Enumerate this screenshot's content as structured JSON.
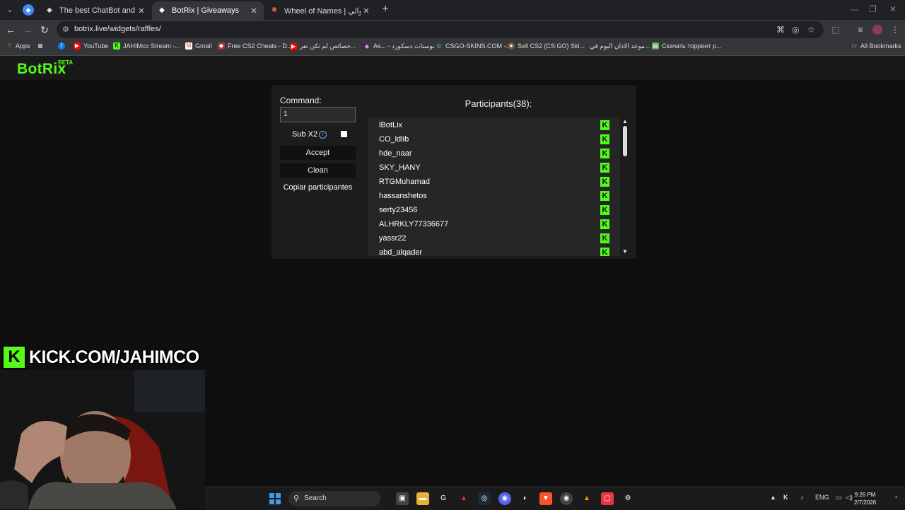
{
  "browser": {
    "tabs": [
      {
        "title": "The best ChatBot and Widgets",
        "favicon": "botrix-diamond-icon",
        "active": false
      },
      {
        "title": "BotRix | Giveaways",
        "favicon": "botrix-diamond-icon",
        "active": true
      },
      {
        "title": "Wheel of Names | اسم العشوائي",
        "favicon": "wheel-icon",
        "active": false
      }
    ],
    "url": "botrix.live/widgets/raffles/",
    "bookmarks": [
      {
        "label": "Apps",
        "icon": "apps-grid-icon"
      },
      {
        "label": "YouTube",
        "icon": "youtube-icon"
      },
      {
        "label": "JAHIMco Stream -...",
        "icon": "kick-icon"
      },
      {
        "label": "Gmail",
        "icon": "gmail-icon"
      },
      {
        "label": "Free CS2 Cheats - D...",
        "icon": "cheats-icon"
      },
      {
        "label": "خصائص لم تكن تعر...",
        "icon": "youtube-icon"
      },
      {
        "label": "As... - بوستات دسكورد",
        "icon": "discord-icon"
      },
      {
        "label": "CSGO-SKINS.COM -...",
        "icon": "csgo-icon"
      },
      {
        "label": "Sell CS2 (CS:GO) Ski...",
        "icon": "skins-icon"
      },
      {
        "label": "موعد الاذان اليوم في...",
        "icon": "prayer-icon"
      },
      {
        "label": "Скачать торрент р...",
        "icon": "torrent-icon"
      },
      {
        "label": "All Bookmarks",
        "icon": "folder-icon"
      }
    ]
  },
  "site": {
    "logo": "BotRix",
    "logo_badge": "BETA"
  },
  "raffle": {
    "command_label": "Command:",
    "command_value": "1",
    "sub_x2_label": "Sub X2",
    "sub_x2_checked": false,
    "accept_label": "Accept",
    "clean_label": "Clean",
    "copy_label": "Copiar participantes",
    "participants_title": "Participants(38):",
    "participants": [
      "lBotLix",
      "CO_ldlib",
      "hde_naar",
      "SKY_HANY",
      "RTGMuhamad",
      "hassanshetos",
      "serty23456",
      "ALHRKLY77336677",
      "yassr22",
      "abd_alqader"
    ],
    "platform_badge": "K"
  },
  "overlay": {
    "kick_letter": "K",
    "kick_url": "KICK.COM/JAHIMCO"
  },
  "taskbar": {
    "search_placeholder": "Search",
    "language": "ENG",
    "time": "9:26 PM",
    "date": "2/7/2026"
  },
  "colors": {
    "kick_green": "#53fc18",
    "page_bg": "#0f0f0f",
    "panel_bg": "#1c1c1c"
  }
}
